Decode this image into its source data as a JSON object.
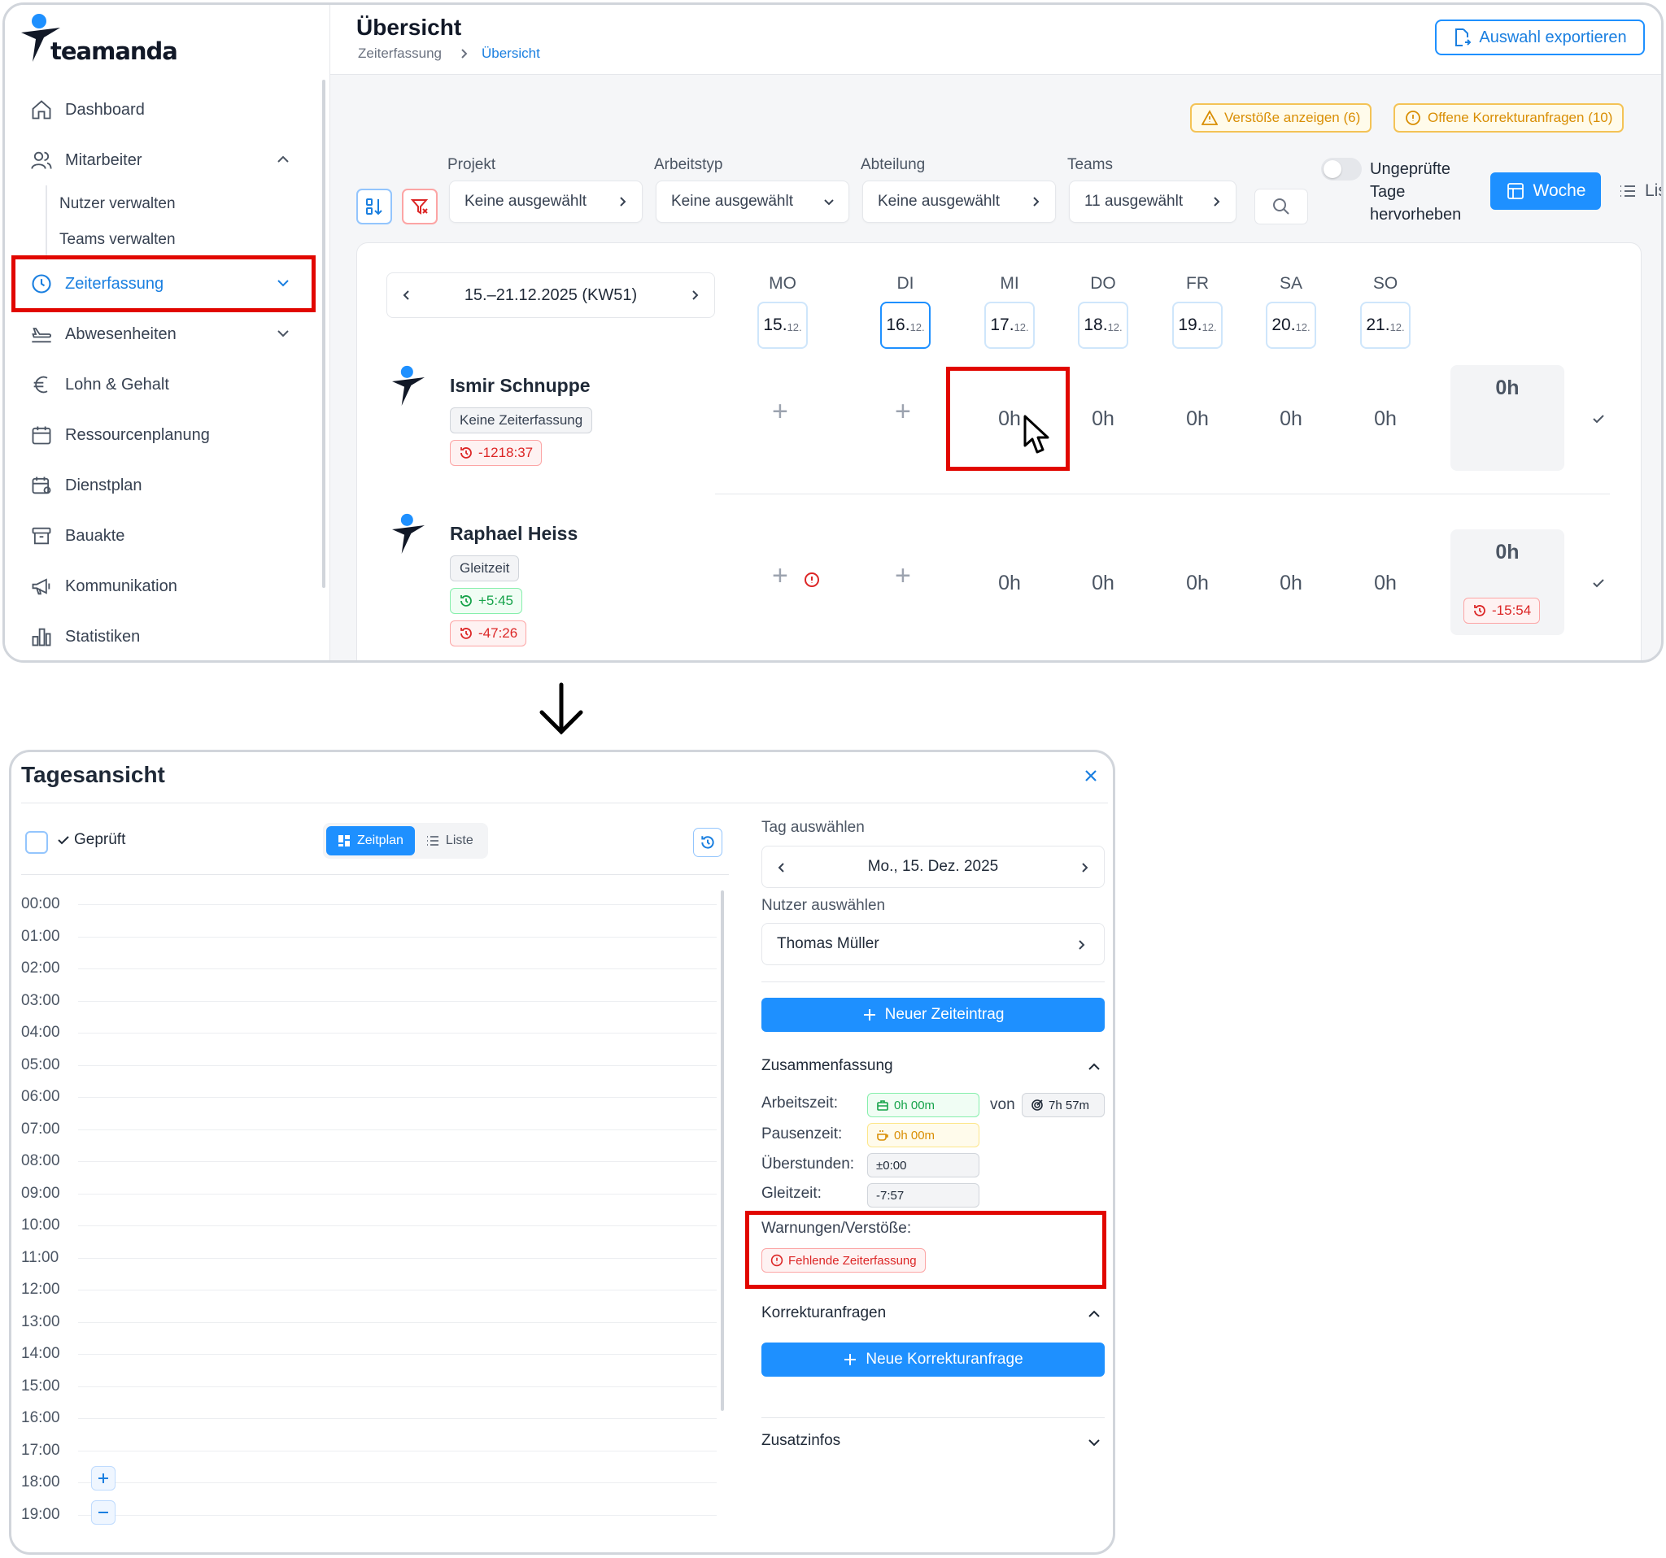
{
  "brand": {
    "name": "teamanda"
  },
  "sidebar": {
    "items": [
      {
        "label": "Dashboard",
        "icon": "home-icon"
      },
      {
        "label": "Mitarbeiter",
        "icon": "users-icon"
      },
      {
        "label": "Zeiterfassung",
        "icon": "clock-icon"
      },
      {
        "label": "Abwesenheiten",
        "icon": "plane-icon"
      },
      {
        "label": "Lohn & Gehalt",
        "icon": "euro-icon"
      },
      {
        "label": "Ressourcenplanung",
        "icon": "calendar-icon"
      },
      {
        "label": "Dienstplan",
        "icon": "calendar-user-icon"
      },
      {
        "label": "Bauakte",
        "icon": "archive-icon"
      },
      {
        "label": "Kommunikation",
        "icon": "megaphone-icon"
      },
      {
        "label": "Statistiken",
        "icon": "bar-chart-icon"
      }
    ],
    "mitarbeiter_sub": [
      "Nutzer verwalten",
      "Teams verwalten"
    ]
  },
  "header": {
    "title": "Übersicht",
    "breadcrumb": [
      "Zeiterfassung",
      "Übersicht"
    ],
    "export_label": "Auswahl exportieren"
  },
  "alerts": {
    "violations": "Verstöße anzeigen (6)",
    "corrections": "Offene Korrekturanfragen (10)"
  },
  "filters": {
    "projekt": {
      "label": "Projekt",
      "value": "Keine ausgewählt"
    },
    "arbeitstyp": {
      "label": "Arbeitstyp",
      "value": "Keine ausgewählt"
    },
    "abteilung": {
      "label": "Abteilung",
      "value": "Keine ausgewählt"
    },
    "teams": {
      "label": "Teams",
      "value": "11 ausgewählt"
    },
    "toggle_label_1": "Ungeprüfte",
    "toggle_label_2": "Tage",
    "toggle_label_3": "hervorheben",
    "view_week": "Woche",
    "view_list": "Lis"
  },
  "week": {
    "range": "15.–21.12.2025 (KW51)",
    "days": [
      {
        "name": "MO",
        "day": "15.",
        "month": "12."
      },
      {
        "name": "DI",
        "day": "16.",
        "month": "12."
      },
      {
        "name": "MI",
        "day": "17.",
        "month": "12."
      },
      {
        "name": "DO",
        "day": "18.",
        "month": "12."
      },
      {
        "name": "FR",
        "day": "19.",
        "month": "12."
      },
      {
        "name": "SA",
        "day": "20.",
        "month": "12."
      },
      {
        "name": "SO",
        "day": "21.",
        "month": "12."
      }
    ]
  },
  "employees": [
    {
      "name": "Ismir Schnuppe",
      "model": "Keine Zeiterfassung",
      "balances": [
        {
          "type": "red",
          "text": "-1218:37"
        }
      ],
      "cells": [
        "0h",
        "0h",
        "0h",
        "0h",
        "0h"
      ],
      "total": "0h",
      "total_badge": ""
    },
    {
      "name": "Raphael Heiss",
      "model": "Gleitzeit",
      "balances": [
        {
          "type": "green",
          "text": "+5:45"
        },
        {
          "type": "red",
          "text": "-47:26"
        }
      ],
      "cells": [
        "0h",
        "0h",
        "0h",
        "0h",
        "0h"
      ],
      "total": "0h",
      "total_badge": "-15:54"
    }
  ],
  "dialog": {
    "title": "Tagesansicht",
    "checked_label": "Geprüft",
    "view_schedule": "Zeitplan",
    "view_list": "Liste",
    "hours": [
      "00:00",
      "01:00",
      "02:00",
      "03:00",
      "04:00",
      "05:00",
      "06:00",
      "07:00",
      "08:00",
      "09:00",
      "10:00",
      "11:00",
      "12:00",
      "13:00",
      "14:00",
      "15:00",
      "16:00",
      "17:00",
      "18:00",
      "19:00"
    ],
    "select_day_label": "Tag auswählen",
    "selected_day": "Mo., 15. Dez. 2025",
    "select_user_label": "Nutzer auswählen",
    "selected_user": "Thomas Müller",
    "new_entry": "Neuer Zeiteintrag",
    "summary_title": "Zusammenfassung",
    "summary": {
      "arbeitszeit_label": "Arbeitszeit:",
      "arbeitszeit": "0h 00m",
      "von": "von",
      "target": "7h 57m",
      "pausenzeit_label": "Pausenzeit:",
      "pausenzeit": "0h 00m",
      "ueberstunden_label": "Überstunden:",
      "ueberstunden": "±0:00",
      "gleitzeit_label": "Gleitzeit:",
      "gleitzeit": "-7:57"
    },
    "warnings_label": "Warnungen/Verstöße:",
    "warning": "Fehlende Zeiterfassung",
    "corrections_title": "Korrekturanfragen",
    "new_correction": "Neue Korrekturanfrage",
    "extra_title": "Zusatzinfos"
  },
  "colors": {
    "accent": "#1e90ff",
    "highlight": "#e10600",
    "warning": "#d98e04"
  }
}
